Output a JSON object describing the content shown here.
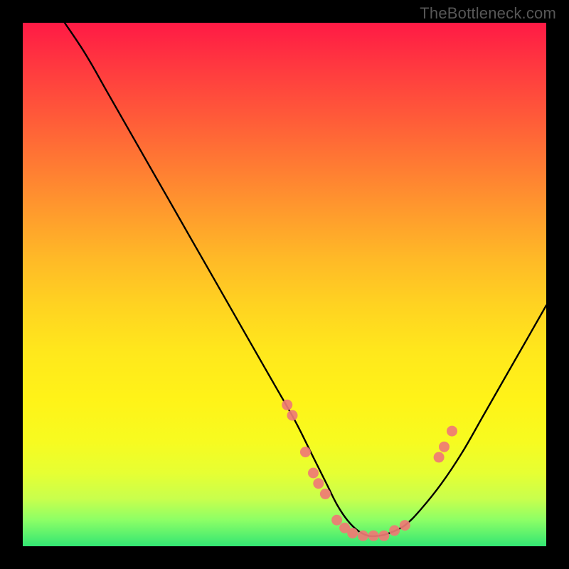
{
  "watermark": "TheBottleneck.com",
  "chart_data": {
    "type": "line",
    "title": "",
    "xlabel": "",
    "ylabel": "",
    "xlim": [
      0,
      100
    ],
    "ylim": [
      0,
      100
    ],
    "curve": {
      "x": [
        8,
        12,
        16,
        20,
        24,
        28,
        32,
        36,
        40,
        44,
        48,
        52,
        55,
        58,
        60,
        62,
        64,
        66,
        68,
        70,
        73,
        76,
        80,
        84,
        88,
        92,
        96,
        100
      ],
      "y": [
        100,
        94,
        87,
        80,
        73,
        66,
        59,
        52,
        45,
        38,
        31,
        24,
        18,
        12,
        8,
        5,
        3,
        2,
        2,
        2.5,
        4,
        7,
        12,
        18,
        25,
        32,
        39,
        46
      ]
    },
    "scatter": {
      "x": [
        50.5,
        51.5,
        54,
        55.5,
        56.5,
        57.8,
        60,
        61.5,
        63,
        65,
        67,
        69,
        71,
        73,
        79.5,
        80.5,
        82
      ],
      "y": [
        27,
        25,
        18,
        14,
        12,
        10,
        5,
        3.5,
        2.5,
        2,
        2,
        2,
        3,
        4,
        17,
        19,
        22
      ]
    },
    "gradient_stops": [
      {
        "pos": 0,
        "color": "#ff1a45"
      },
      {
        "pos": 50,
        "color": "#ffd321"
      },
      {
        "pos": 100,
        "color": "#33e673"
      }
    ]
  }
}
